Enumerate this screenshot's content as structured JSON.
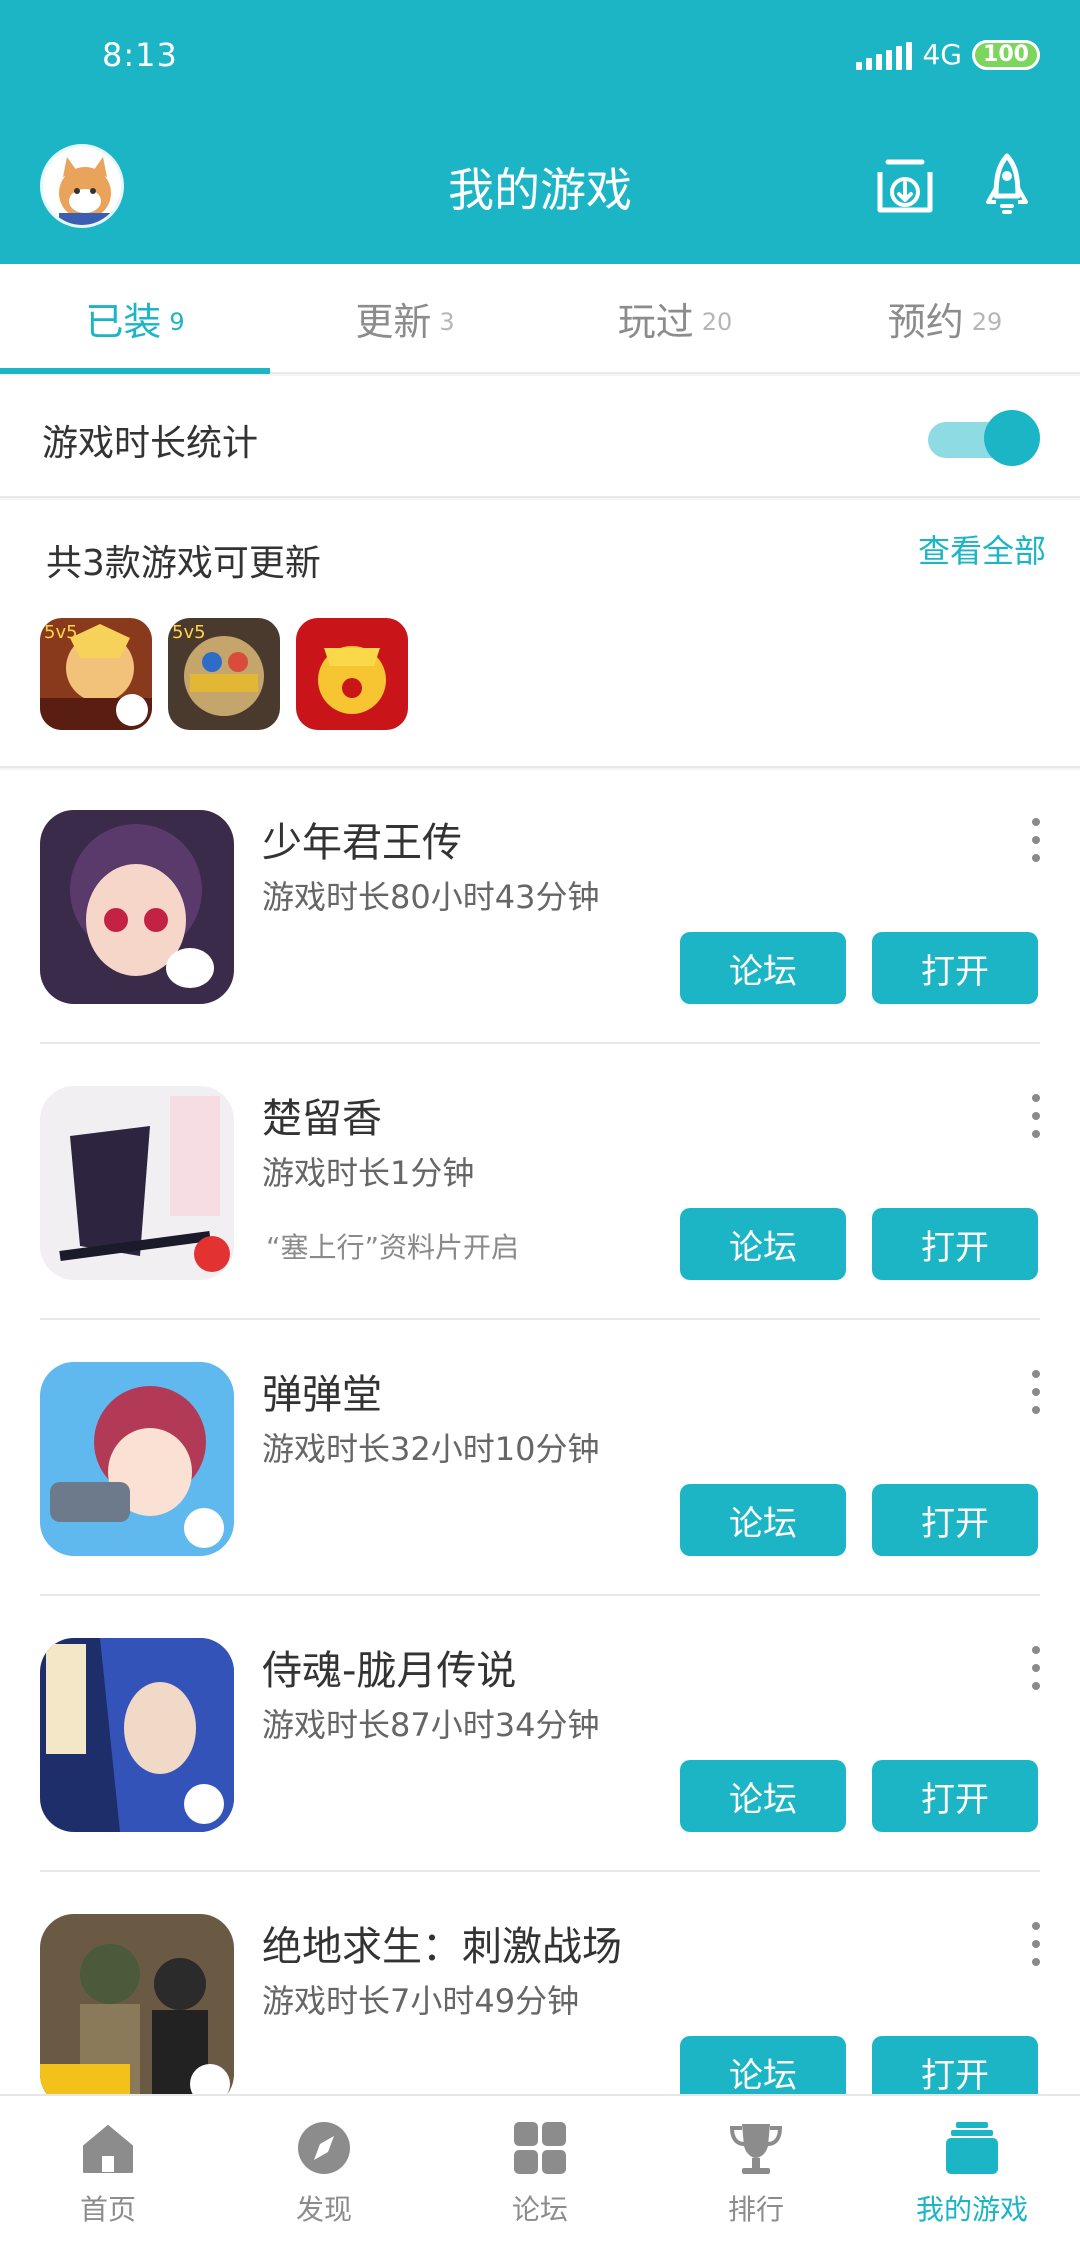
{
  "status": {
    "time": "8:13",
    "network": "4G",
    "battery": "100"
  },
  "header": {
    "title": "我的游戏"
  },
  "tabs": [
    {
      "label": "已装",
      "count": "9"
    },
    {
      "label": "更新",
      "count": "3"
    },
    {
      "label": "玩过",
      "count": "20"
    },
    {
      "label": "预约",
      "count": "29"
    }
  ],
  "stats": {
    "label": "游戏时长统计",
    "enabled": true
  },
  "updates": {
    "label": "共3款游戏可更新",
    "view_all": "查看全部"
  },
  "games": [
    {
      "name": "少年君王传",
      "time": "游戏时长80小时43分钟",
      "note": ""
    },
    {
      "name": "楚留香",
      "time": "游戏时长1分钟",
      "note": "“塞上行”资料片开启"
    },
    {
      "name": "弹弹堂",
      "time": "游戏时长32小时10分钟",
      "note": ""
    },
    {
      "name": "侍魂-胧月传说",
      "time": "游戏时长87小时34分钟",
      "note": ""
    },
    {
      "name": "绝地求生：刺激战场",
      "time": "游戏时长7小时49分钟",
      "note": ""
    }
  ],
  "buttons": {
    "forum": "论坛",
    "open": "打开"
  },
  "nav": [
    {
      "label": "首页"
    },
    {
      "label": "发现"
    },
    {
      "label": "论坛"
    },
    {
      "label": "排行"
    },
    {
      "label": "我的游戏"
    }
  ],
  "colors": {
    "accent": "#1bb5c6",
    "toggle_track": "#8fdbe3",
    "battery": "#7cd65e"
  }
}
